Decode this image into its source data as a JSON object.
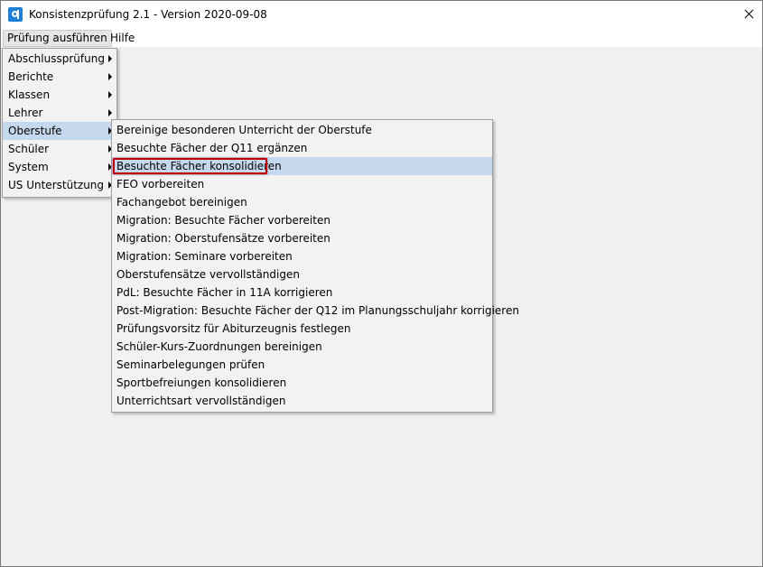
{
  "window": {
    "title": "Konsistenzprüfung 2.1 - Version 2020-09-08",
    "icon": "app-logo-icon",
    "accent_color": "#1e7fd6"
  },
  "menubar": [
    {
      "label": "Prüfung ausführen",
      "active": true
    },
    {
      "label": "Hilfe",
      "active": false
    }
  ],
  "main_menu": [
    {
      "label": "Abschlussprüfung"
    },
    {
      "label": "Berichte"
    },
    {
      "label": "Klassen"
    },
    {
      "label": "Lehrer"
    },
    {
      "label": "Oberstufe",
      "highlighted": true
    },
    {
      "label": "Schüler"
    },
    {
      "label": "System"
    },
    {
      "label": "US Unterstützung"
    }
  ],
  "submenu": {
    "parent": "Oberstufe",
    "items": [
      {
        "label": "Bereinige besonderen Unterricht der Oberstufe"
      },
      {
        "label": "Besuchte Fächer der Q11 ergänzen"
      },
      {
        "label": "Besuchte Fächer konsolidieren",
        "highlighted": true,
        "annotated": true
      },
      {
        "label": "FEO vorbereiten"
      },
      {
        "label": "Fachangebot bereinigen"
      },
      {
        "label": "Migration: Besuchte Fächer vorbereiten"
      },
      {
        "label": "Migration: Oberstufensätze vorbereiten"
      },
      {
        "label": "Migration: Seminare vorbereiten"
      },
      {
        "label": "Oberstufensätze vervollständigen"
      },
      {
        "label": "PdL: Besuchte Fächer in 11A korrigieren"
      },
      {
        "label": "Post-Migration: Besuchte Fächer der Q12 im Planungsschuljahr korrigieren"
      },
      {
        "label": "Prüfungsvorsitz für Abiturzeugnis festlegen"
      },
      {
        "label": "Schüler-Kurs-Zuordnungen bereinigen"
      },
      {
        "label": "Seminarbelegungen prüfen"
      },
      {
        "label": "Sportbefreiungen konsolidieren"
      },
      {
        "label": "Unterrichtsart vervollständigen"
      }
    ]
  },
  "colors": {
    "menu_highlight": "#c5d8ee",
    "annotation_box": "#c00000",
    "content_background": "#f0f0f0"
  }
}
